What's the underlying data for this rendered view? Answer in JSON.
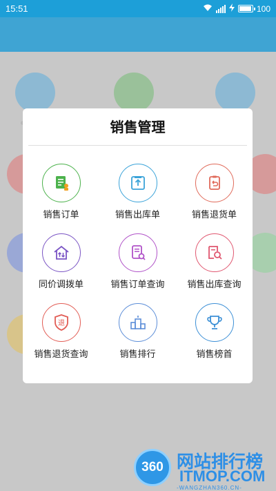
{
  "status_bar": {
    "time": "15:51",
    "battery_text": "100",
    "battery_level": 1.0
  },
  "dialog": {
    "title": "销售管理",
    "items": [
      {
        "label": "销售订单",
        "icon": "order-icon",
        "color": "#4cb24c"
      },
      {
        "label": "销售出库单",
        "icon": "outbound-box-icon",
        "color": "#3aa3d9"
      },
      {
        "label": "销售退货单",
        "icon": "return-clipboard-icon",
        "color": "#e06a5a"
      },
      {
        "label": "同价调拨单",
        "icon": "transfer-house-icon",
        "color": "#7a54c4"
      },
      {
        "label": "销售订单查询",
        "icon": "order-search-icon",
        "color": "#b052c8"
      },
      {
        "label": "销售出库查询",
        "icon": "outbound-search-icon",
        "color": "#e0566f"
      },
      {
        "label": "销售退货查询",
        "icon": "return-shield-icon",
        "color": "#e25c54"
      },
      {
        "label": "销售排行",
        "icon": "ranking-podium-icon",
        "color": "#5b8dd8"
      },
      {
        "label": "销售榜首",
        "icon": "trophy-icon",
        "color": "#3b8fd6"
      }
    ]
  },
  "watermark": {
    "badge": "360",
    "title": "网站排行榜",
    "subtitle": "ITMOP.COM",
    "url": "-WANGZHAN360.CN-"
  }
}
